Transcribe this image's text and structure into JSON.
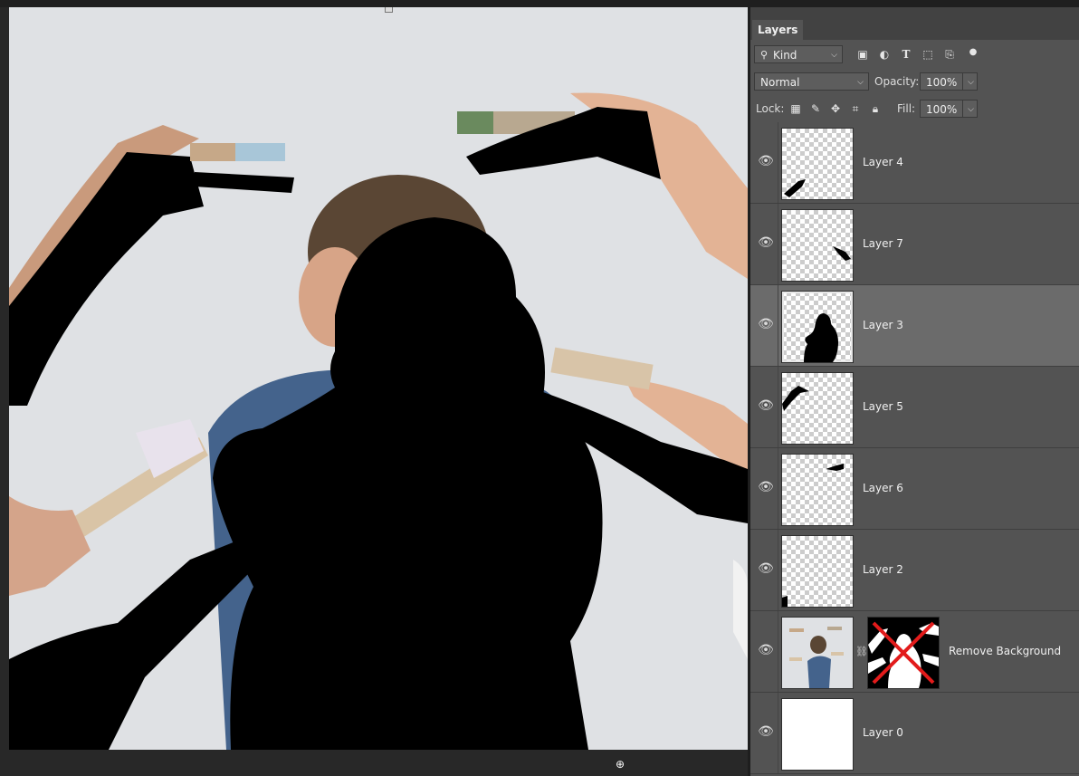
{
  "panel": {
    "tab_label": "Layers",
    "filter": {
      "label": "Kind",
      "icons": [
        "image-filter-icon",
        "adjustment-filter-icon",
        "type-filter-icon",
        "shape-filter-icon",
        "smart-object-filter-icon",
        "filter-toggle-icon"
      ]
    },
    "blend_mode": "Normal",
    "opacity_label": "Opacity:",
    "opacity_value": "100%",
    "lock_label": "Lock:",
    "lock_icons": [
      "lock-transparent-pixels-icon",
      "lock-image-pixels-icon",
      "lock-position-icon",
      "lock-artboard-icon",
      "lock-all-icon"
    ],
    "fill_label": "Fill:",
    "fill_value": "100%"
  },
  "layers": [
    {
      "name": "Layer 4",
      "visible": true,
      "selected": false
    },
    {
      "name": "Layer 7",
      "visible": true,
      "selected": false
    },
    {
      "name": "Layer 3",
      "visible": true,
      "selected": true
    },
    {
      "name": "Layer 5",
      "visible": true,
      "selected": false
    },
    {
      "name": "Layer 6",
      "visible": true,
      "selected": false
    },
    {
      "name": "Layer 2",
      "visible": true,
      "selected": false
    },
    {
      "name": "Remove Background",
      "visible": true,
      "selected": false,
      "has_mask": true,
      "mask_disabled": true
    },
    {
      "name": "Layer 0",
      "visible": true,
      "selected": false
    }
  ],
  "colors": {
    "panel_bg": "#535353",
    "selected_bg": "#6b6b6b",
    "canvas_bg": "#dfe1e4",
    "mask_disabled_x": "#e21b1b"
  }
}
